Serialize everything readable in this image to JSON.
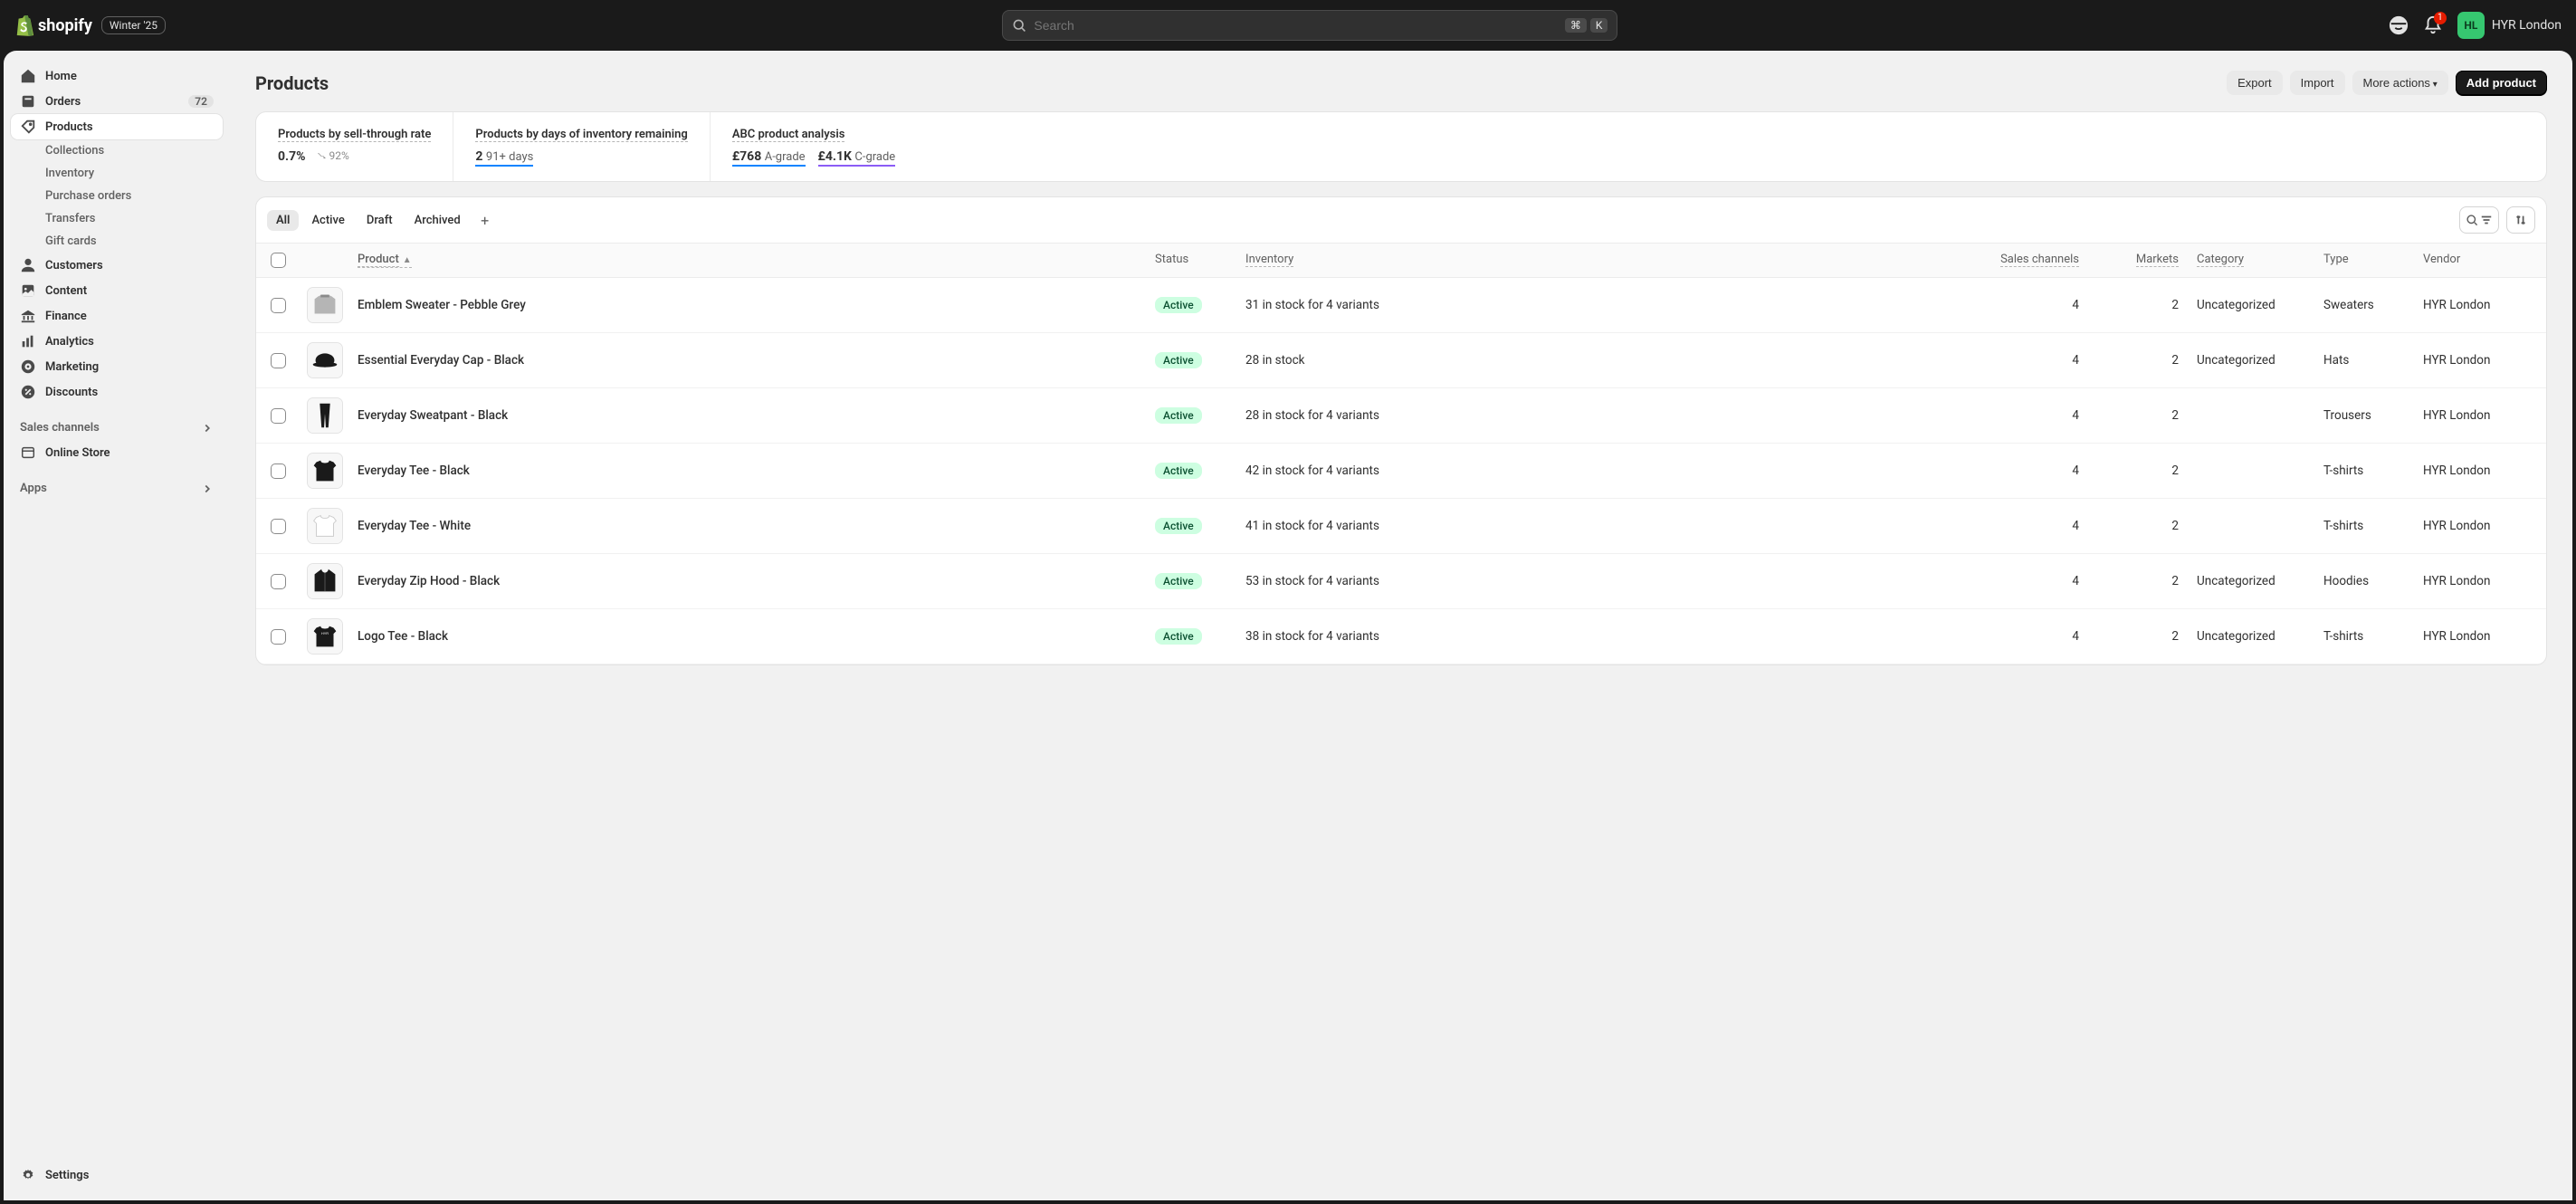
{
  "topbar": {
    "brand": "shopify",
    "season": "Winter '25",
    "search_placeholder": "Search",
    "kbd1": "⌘",
    "kbd2": "K",
    "notif_count": "1",
    "store_initials": "HL",
    "store_name": "HYR London"
  },
  "sidebar": {
    "home": "Home",
    "orders": "Orders",
    "orders_badge": "72",
    "products": "Products",
    "sub": {
      "collections": "Collections",
      "inventory": "Inventory",
      "purchase_orders": "Purchase orders",
      "transfers": "Transfers",
      "gift_cards": "Gift cards"
    },
    "customers": "Customers",
    "content": "Content",
    "finance": "Finance",
    "analytics": "Analytics",
    "marketing": "Marketing",
    "discounts": "Discounts",
    "sales_channels": "Sales channels",
    "online_store": "Online Store",
    "apps": "Apps",
    "settings": "Settings"
  },
  "page": {
    "title": "Products",
    "export": "Export",
    "import": "Import",
    "more_actions": "More actions",
    "add_product": "Add product"
  },
  "metrics": {
    "m1_title": "Products by sell-through rate",
    "m1_val": "0.7%",
    "m1_delta": "92%",
    "m2_title": "Products by days of inventory remaining",
    "m2_val": "2",
    "m2_sub": "91+ days",
    "m3_title": "ABC product analysis",
    "m3_val1": "£768",
    "m3_sub1": "A-grade",
    "m3_val2": "£4.1K",
    "m3_sub2": "C-grade"
  },
  "tabs": {
    "all": "All",
    "active": "Active",
    "draft": "Draft",
    "archived": "Archived"
  },
  "columns": {
    "product": "Product",
    "status": "Status",
    "inventory": "Inventory",
    "sales": "Sales channels",
    "markets": "Markets",
    "category": "Category",
    "type": "Type",
    "vendor": "Vendor"
  },
  "rows": [
    {
      "name": "Emblem Sweater - Pebble Grey",
      "status": "Active",
      "inventory": "31 in stock for 4 variants",
      "sales": "4",
      "markets": "2",
      "category": "Uncategorized",
      "type": "Sweaters",
      "vendor": "HYR London"
    },
    {
      "name": "Essential Everyday Cap - Black",
      "status": "Active",
      "inventory": "28 in stock",
      "sales": "4",
      "markets": "2",
      "category": "Uncategorized",
      "type": "Hats",
      "vendor": "HYR London"
    },
    {
      "name": "Everyday Sweatpant - Black",
      "status": "Active",
      "inventory": "28 in stock for 4 variants",
      "sales": "4",
      "markets": "2",
      "category": "",
      "type": "Trousers",
      "vendor": "HYR London"
    },
    {
      "name": "Everyday Tee - Black",
      "status": "Active",
      "inventory": "42 in stock for 4 variants",
      "sales": "4",
      "markets": "2",
      "category": "",
      "type": "T-shirts",
      "vendor": "HYR London"
    },
    {
      "name": "Everyday Tee - White",
      "status": "Active",
      "inventory": "41 in stock for 4 variants",
      "sales": "4",
      "markets": "2",
      "category": "",
      "type": "T-shirts",
      "vendor": "HYR London"
    },
    {
      "name": "Everyday Zip Hood - Black",
      "status": "Active",
      "inventory": "53 in stock for 4 variants",
      "sales": "4",
      "markets": "2",
      "category": "Uncategorized",
      "type": "Hoodies",
      "vendor": "HYR London"
    },
    {
      "name": "Logo Tee - Black",
      "status": "Active",
      "inventory": "38 in stock for 4 variants",
      "sales": "4",
      "markets": "2",
      "category": "Uncategorized",
      "type": "T-shirts",
      "vendor": "HYR London"
    }
  ]
}
